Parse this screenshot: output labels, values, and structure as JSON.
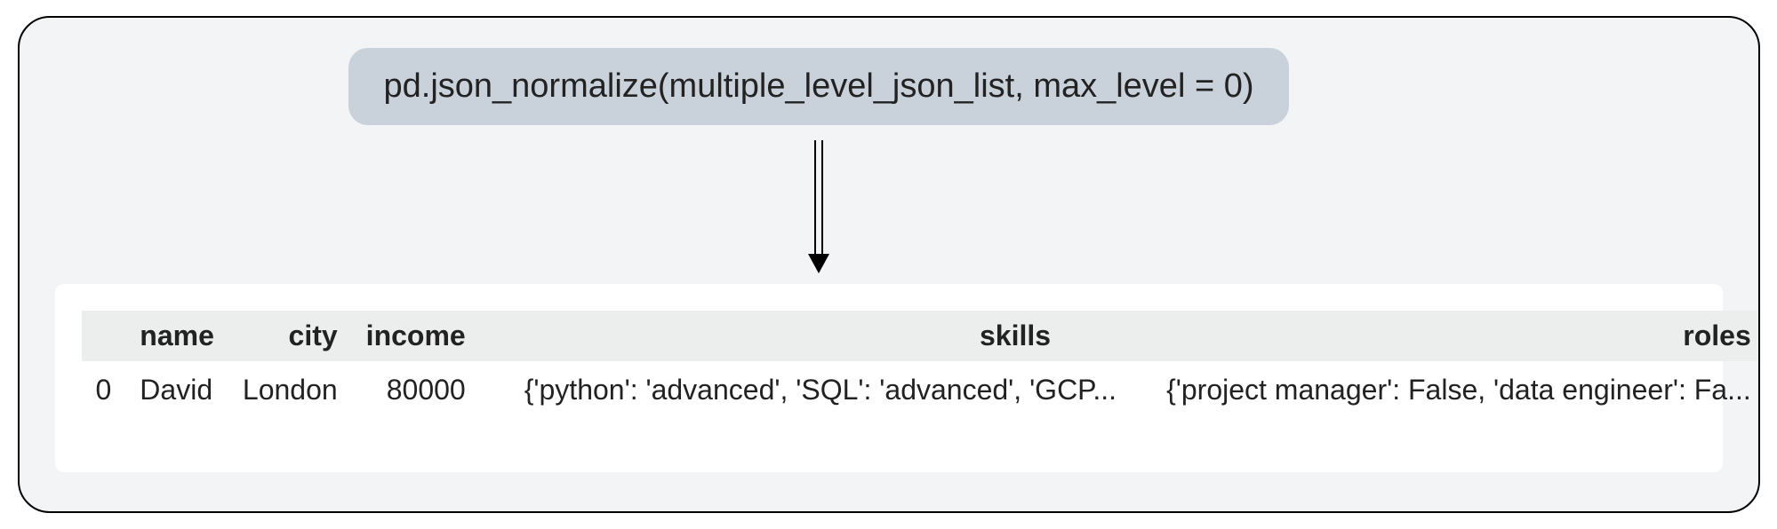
{
  "code_line": "pd.json_normalize(multiple_level_json_list, max_level = 0)",
  "table": {
    "headers": {
      "index": "",
      "name": "name",
      "city": "city",
      "income": "income",
      "skills": "skills",
      "roles": "roles"
    },
    "rows": [
      {
        "index": "0",
        "name": "David",
        "city": "London",
        "income": "80000",
        "skills": "{'python': 'advanced', 'SQL': 'advanced', 'GCP...",
        "roles": "{'project manager': False, 'data engineer': Fa..."
      }
    ]
  },
  "chart_data": {
    "type": "table",
    "title": "pd.json_normalize(multiple_level_json_list, max_level = 0)",
    "columns": [
      "name",
      "city",
      "income",
      "skills",
      "roles"
    ],
    "rows": [
      {
        "index": 0,
        "name": "David",
        "city": "London",
        "income": 80000,
        "skills": "{'python': 'advanced', 'SQL': 'advanced', 'GCP...",
        "roles": "{'project manager': False, 'data engineer': Fa..."
      }
    ]
  }
}
